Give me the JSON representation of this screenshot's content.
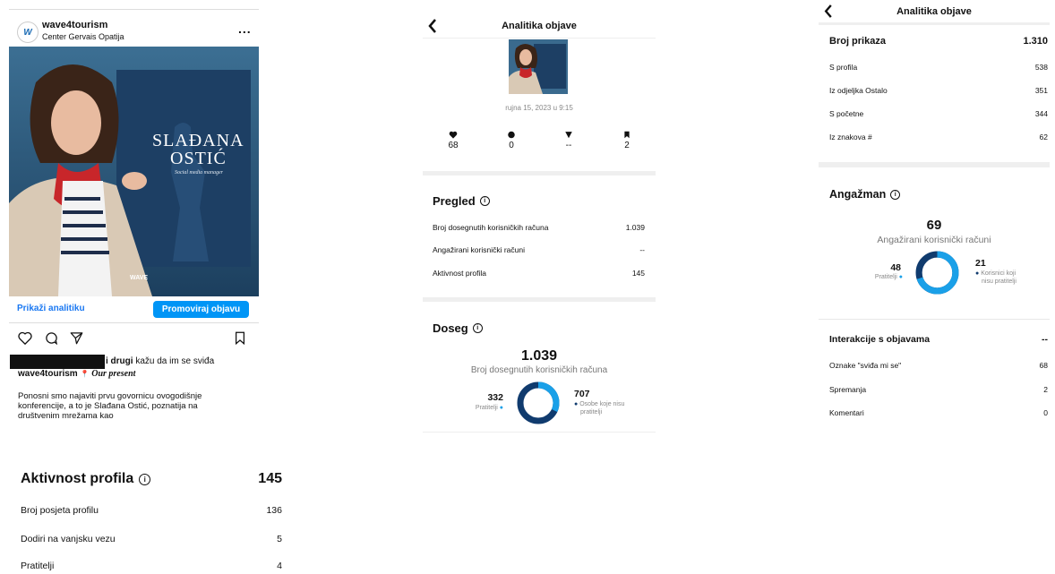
{
  "colors": {
    "brand_blue": "#0095f6",
    "poster_blue": "#1d3f64",
    "donut_light": "#1aa0e8",
    "donut_dark": "#103b6e",
    "divider": "#efefef"
  },
  "post": {
    "account_name": "wave4tourism",
    "location": "Center Gervais Opatija",
    "more_label": "...",
    "avatar_label": "W",
    "poster_name_line1": "SLAĐANA",
    "poster_name_line2": "OSTIĆ",
    "poster_subtitle": "Social media manager",
    "poster_logo_text": "WAVE",
    "show_analytics_label": "Prikaži analitiku",
    "promote_label": "Promoviraj objavu",
    "likes_text_bold": "i drugi",
    "likes_text_rest": " kažu da im se sviđa",
    "caption_account": "wave4tourism",
    "caption_pin": "📍",
    "caption_tag": "Our present",
    "caption_body": "Ponosni smo najaviti prvu govornicu ovogodišnje konferencije, a to je Slađana Ostić, poznatija na društvenim mrežama kao"
  },
  "profile_activity": {
    "title": "Aktivnost profila",
    "total": "145",
    "rows": [
      {
        "label": "Broj posjeta profilu",
        "value": "136"
      },
      {
        "label": "Dodiri na vanjsku vezu",
        "value": "5"
      },
      {
        "label": "Pratitelji",
        "value": "4"
      }
    ]
  },
  "analytics_middle": {
    "title": "Analitika objave",
    "date": "rujna 15, 2023 u 9:15",
    "stats": [
      {
        "icon": "heart-icon",
        "value": "68"
      },
      {
        "icon": "comment-icon",
        "value": "0"
      },
      {
        "icon": "share-icon",
        "value": "--"
      },
      {
        "icon": "bookmark-icon",
        "value": "2"
      }
    ],
    "overview_title": "Pregled",
    "overview_rows": [
      {
        "label": "Broj dosegnutih korisničkih računa",
        "value": "1.039"
      },
      {
        "label": "Angažirani korisnički računi",
        "value": "--"
      },
      {
        "label": "Aktivnost profila",
        "value": "145"
      }
    ],
    "reach_title": "Doseg",
    "reach_total": "1.039",
    "reach_subtitle": "Broj dosegnutih korisničkih računa",
    "reach_followers_value": "332",
    "reach_followers_label": "Pratitelji",
    "reach_nonfollowers_value": "707",
    "reach_nonfollowers_label_line1": "Osobe koje nisu",
    "reach_nonfollowers_label_line2": "pratitelji",
    "reach_followers_fraction": 0.32
  },
  "analytics_right": {
    "title": "Analitika objave",
    "views_title": "Broj prikaza",
    "views_total": "1.310",
    "views_rows": [
      {
        "label": "S profila",
        "value": "538"
      },
      {
        "label": "Iz odjeljka Ostalo",
        "value": "351"
      },
      {
        "label": "S početne",
        "value": "344"
      },
      {
        "label": "Iz znakova #",
        "value": "62"
      }
    ],
    "engagement_title": "Angažman",
    "engagement_total": "69",
    "engagement_subtitle": "Angažirani korisnički računi",
    "eng_followers_value": "48",
    "eng_followers_label": "Pratitelji",
    "eng_nonfollowers_value": "21",
    "eng_nonfollowers_label_line1": "Korisnici koji",
    "eng_nonfollowers_label_line2": "nisu pratitelji",
    "eng_followers_fraction": 0.7,
    "interactions_title": "Interakcije s objavama",
    "interactions_total": "--",
    "interaction_rows": [
      {
        "label": "Oznake \"sviđa mi se\"",
        "value": "68"
      },
      {
        "label": "Spremanja",
        "value": "2"
      },
      {
        "label": "Komentari",
        "value": "0"
      }
    ]
  }
}
